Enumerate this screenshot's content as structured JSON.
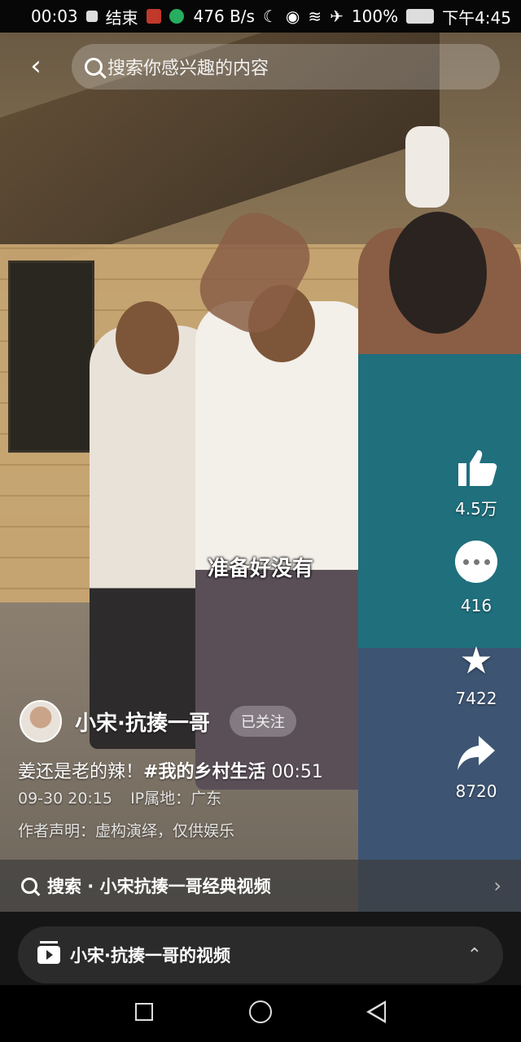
{
  "status_bar": {
    "time": "00:03",
    "app_label": "结束",
    "net_speed": "476 B/s",
    "battery": "100%",
    "clock": "下午4:45"
  },
  "top_bar": {
    "search_placeholder": "搜索你感兴趣的内容"
  },
  "video": {
    "subtitle": "准备好没有"
  },
  "actions": {
    "likes": "4.5万",
    "comments": "416",
    "favorites": "7422",
    "shares": "8720"
  },
  "author": {
    "name": "小宋·抗揍一哥",
    "follow_status": "已关注"
  },
  "post": {
    "caption": "姜还是老的辣！",
    "hashtag": "#我的乡村生活",
    "duration": "00:51",
    "date": "09-30 20:15",
    "ip_location": "IP属地：广东",
    "disclaimer": "作者声明：虚构演绎，仅供娱乐"
  },
  "related_search": {
    "text": "搜索 · 小宋抗揍一哥经典视频"
  },
  "collection": {
    "text": "小宋·抗揍一哥的视频"
  }
}
